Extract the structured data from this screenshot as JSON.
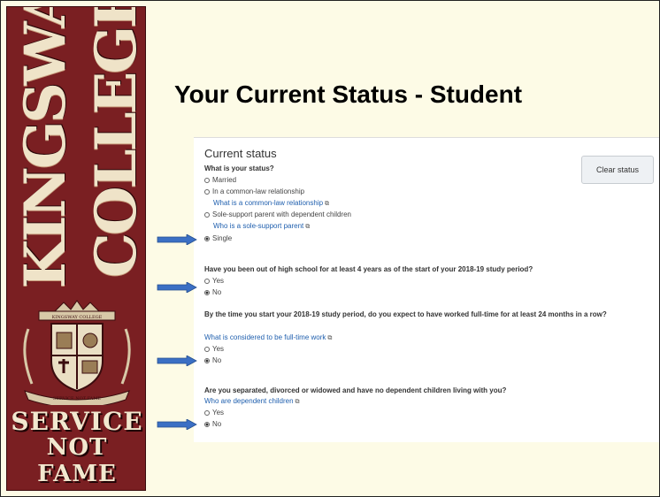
{
  "sidebar": {
    "college_line1": "KINGSWAY",
    "college_line2": "COLLEGE",
    "crest_text_top": "KINGSWAY COLLEGE",
    "crest_text_bottom": "SERVICE NOT FAME",
    "motto_line1": "SERVICE",
    "motto_line2": "NOT",
    "motto_line3": "FAME",
    "colors": {
      "background": "#7a1f22",
      "text": "#efe3c8"
    }
  },
  "slide": {
    "title": "Your Current Status - Student"
  },
  "form": {
    "heading": "Current status",
    "clear_label": "Clear status",
    "q1": {
      "question": "What is your status?",
      "options": [
        "Married",
        "In a common-law relationship",
        "Sole-support parent with dependent children",
        "Single"
      ],
      "link1": "What is a common-law relationship",
      "link2": "Who is a sole-support parent",
      "selected": "Single"
    },
    "q2": {
      "question": "Have you been out of high school for at least 4 years as of the start of your 2018-19 study period?",
      "options": [
        "Yes",
        "No"
      ],
      "selected": "No"
    },
    "q3": {
      "question": "By the time you start your 2018-19 study period, do you expect to have worked full-time for at least 24 months in a row?",
      "link": "What is considered to be full-time work",
      "options": [
        "Yes",
        "No"
      ],
      "selected": "No"
    },
    "q4": {
      "question": "Are you separated, divorced or widowed and have no dependent children living with you?",
      "link": "Who are dependent children",
      "options": [
        "Yes",
        "No"
      ],
      "selected": "No"
    }
  },
  "icons": {
    "arrow": "right-arrow-icon",
    "external": "external-link-icon"
  },
  "colors": {
    "link": "#1f5fae",
    "arrow": "#3b6fc4",
    "slide_bg": "#fdfbe6"
  }
}
